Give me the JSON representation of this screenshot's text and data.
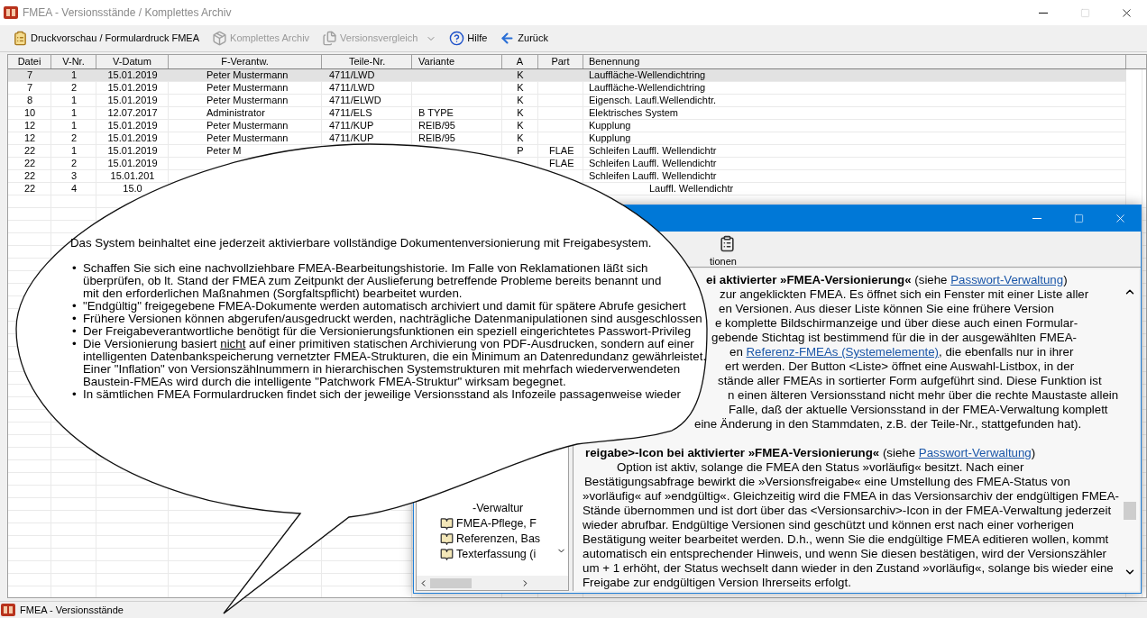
{
  "window": {
    "title": "FMEA - Versionsstände / Komplettes Archiv"
  },
  "toolbar": [
    {
      "kind": "print",
      "label": "Druckvorschau / Formulardruck FMEA",
      "disabled": false,
      "dropdown": false
    },
    {
      "kind": "archive",
      "label": "Komplettes Archiv",
      "disabled": true,
      "dropdown": false
    },
    {
      "kind": "compare",
      "label": "Versionsvergleich",
      "disabled": true,
      "dropdown": true
    },
    {
      "kind": "help",
      "label": "Hilfe",
      "disabled": false,
      "dropdown": false
    },
    {
      "kind": "back",
      "label": "Zurück",
      "disabled": false,
      "dropdown": false
    }
  ],
  "table": {
    "columns": [
      "Datei",
      "V-Nr.",
      "V-Datum",
      "F-Verantw.",
      "Teile-Nr.",
      "Variante",
      "A",
      "Part",
      "Benennung"
    ],
    "rows": [
      {
        "selected": true,
        "cells": [
          "7",
          "1",
          "15.01.2019",
          "Peter Mustermann",
          "4711/LWD",
          "",
          "K",
          "",
          "Lauffläche-Wellendichtring"
        ]
      },
      {
        "selected": false,
        "cells": [
          "7",
          "2",
          "15.01.2019",
          "Peter Mustermann",
          "4711/LWD",
          "",
          "K",
          "",
          "Lauffläche-Wellendichtring"
        ]
      },
      {
        "selected": false,
        "cells": [
          "8",
          "1",
          "15.01.2019",
          "Peter Mustermann",
          "4711/ELWD",
          "",
          "K",
          "",
          "Eigensch. Laufl.Wellendichtr."
        ]
      },
      {
        "selected": false,
        "cells": [
          "10",
          "1",
          "12.07.2017",
          "Administrator",
          "4711/ELS",
          "B  TYPE",
          "K",
          "",
          "Elektrisches System"
        ]
      },
      {
        "selected": false,
        "cells": [
          "12",
          "1",
          "15.01.2019",
          "Peter Mustermann",
          "4711/KUP",
          "REIB/95",
          "K",
          "",
          "Kupplung"
        ]
      },
      {
        "selected": false,
        "cells": [
          "12",
          "2",
          "15.01.2019",
          "Peter Mustermann",
          "4711/KUP",
          "REIB/95",
          "K",
          "",
          "Kupplung"
        ]
      },
      {
        "selected": false,
        "cells": [
          "22",
          "1",
          "15.01.2019",
          "Peter M",
          "",
          "",
          "P",
          "FLAE",
          "Schleifen Lauffl. Wellendichtr"
        ]
      },
      {
        "selected": false,
        "cells": [
          "22",
          "2",
          "15.01.2019",
          "",
          "",
          "",
          "",
          "FLAE",
          "Schleifen Lauffl. Wellendichtr"
        ]
      },
      {
        "selected": false,
        "cells": [
          "22",
          "3",
          "15.01.201",
          "",
          "",
          "",
          "",
          "",
          "Schleifen Lauffl. Wellendichtr"
        ]
      },
      {
        "selected": false,
        "cells": [
          "22",
          "4",
          "15.0",
          "",
          "",
          "",
          "",
          "",
          "Lauffl. Wellendichtr"
        ]
      }
    ]
  },
  "help_window": {
    "toolbar_label": "tionen",
    "tree_items": [
      {
        "kind": "clipped",
        "label": "-Verwaltur"
      },
      {
        "kind": "item",
        "label": "FMEA-Pflege, F"
      },
      {
        "kind": "item",
        "label": "Referenzen, Bas"
      },
      {
        "kind": "item",
        "label": "Texterfassung (i"
      }
    ],
    "paragraphs": [
      {
        "lines": [
          [
            {
              "kind": "bold",
              "text": "ei aktivierter »FMEA-Versionierung«"
            },
            {
              "kind": "text",
              "text": " (siehe "
            },
            {
              "kind": "link",
              "text": "Passwort-Verwaltung"
            },
            {
              "kind": "text",
              "text": ")"
            }
          ],
          [
            {
              "kind": "text",
              "text": "zur angeklickten FMEA. Es öffnet sich ein Fenster mit einer Liste aller"
            }
          ],
          [
            {
              "kind": "text",
              "text": "en Versionen. Aus dieser Liste können Sie eine frühere Version"
            }
          ],
          [
            {
              "kind": "text",
              "text": "e komplette Bildschirmanzeige und über diese auch einen Formular-"
            }
          ],
          [
            {
              "kind": "text",
              "text": "gebende Stichtag ist bestimmend für die in der ausgewählten FMEA-"
            }
          ],
          [
            {
              "kind": "text",
              "text": "en "
            },
            {
              "kind": "link",
              "text": "Referenz-FMEAs (Systemelemente)"
            },
            {
              "kind": "text",
              "text": ", die ebenfalls nur in ihrer"
            }
          ],
          [
            {
              "kind": "text",
              "text": "ert werden. Der Button <Liste> öffnet eine Auswahl-Listbox, in der"
            }
          ],
          [
            {
              "kind": "text",
              "text": "stände aller FMEAs in sortierter Form aufgeführt sind. Diese Funktion ist"
            }
          ],
          [
            {
              "kind": "text",
              "text": "n einen älteren Versionsstand nicht mehr über die rechte Maustaste allein"
            }
          ],
          [
            {
              "kind": "text",
              "text": "Falle, daß der aktuelle Versionsstand in der FMEA-Verwaltung komplett"
            }
          ],
          [
            {
              "kind": "text",
              "text": "eine Änderung in den Stammdaten, z.B. der Teile-Nr., stattgefunden hat)."
            }
          ]
        ]
      },
      {
        "lines": [
          [
            {
              "kind": "bold",
              "text": "reigabe>-Icon bei aktivierter »FMEA-Versionierung«"
            },
            {
              "kind": "text",
              "text": " (siehe "
            },
            {
              "kind": "link",
              "text": "Passwort-Verwaltung"
            },
            {
              "kind": "text",
              "text": ")"
            }
          ],
          [
            {
              "kind": "text",
              "text": "Option ist aktiv, solange die FMEA den Status »vorläufig« besitzt. Nach einer"
            }
          ],
          [
            {
              "kind": "text",
              "text": "Bestätigungsabfrage bewirkt die »Versionsfreigabe« eine Umstellung des FMEA-Status von"
            }
          ],
          [
            {
              "kind": "text",
              "text": "»vorläufig« auf »endgültig«. Gleichzeitig wird die FMEA in das Versionsarchiv der endgültigen FMEA-"
            }
          ],
          [
            {
              "kind": "text",
              "text": "Stände übernommen und ist dort über das <Versionsarchiv>-Icon in der FMEA-Verwaltung jederzeit"
            }
          ],
          [
            {
              "kind": "text",
              "text": "wieder abrufbar. Endgültige Versionen sind geschützt und können erst nach einer vorherigen"
            }
          ],
          [
            {
              "kind": "text",
              "text": "Bestätigung weiter bearbeitet werden. D.h., wenn Sie die endgültige FMEA editieren wollen, kommt"
            }
          ],
          [
            {
              "kind": "text",
              "text": "automatisch ein entsprechender Hinweis, und wenn Sie diesen bestätigen, wird der Versionszähler"
            }
          ],
          [
            {
              "kind": "text",
              "text": "um + 1 erhöht, der Status wechselt dann wieder in den Zustand »vorläufig«, solange bis wieder eine"
            }
          ],
          [
            {
              "kind": "text",
              "text": "Freigabe zur endgültigen Version Ihrerseits erfolgt."
            }
          ]
        ]
      }
    ]
  },
  "callout": {
    "intro": "Das System beinhaltet eine jederzeit aktivierbare vollständige Dokumentenversionierung mit Freigabesystem.",
    "bullets": [
      {
        "marker": "•",
        "segments": [
          {
            "kind": "text",
            "text": "Schaffen Sie sich eine nachvollziehbare FMEA-Bearbeitungshistorie. Im Falle von Reklamationen läßt sich\nüberprüfen, ob lt. Stand der FMEA zum Zeitpunkt der Auslieferung betreffende Probleme bereits benannt und\nmit den erforderlichen Maßnahmen (Sorgfaltspflicht) bearbeitet wurden."
          }
        ]
      },
      {
        "marker": "•",
        "segments": [
          {
            "kind": "text",
            "text": "\"Endgültig\" freigegebene FMEA-Dokumente werden automatisch archiviert und damit für spätere Abrufe gesichert"
          }
        ]
      },
      {
        "marker": "•",
        "segments": [
          {
            "kind": "text",
            "text": "Frühere Versionen können abgerufen/ausgedruckt werden, nachträgliche Datenmanipulationen sind ausgeschlossen"
          }
        ]
      },
      {
        "marker": "•",
        "segments": [
          {
            "kind": "text",
            "text": "Der Freigabeverantwortliche benötigt für die Versionierungsfunktionen ein speziell eingerichtetes Passwort-Privileg"
          }
        ]
      },
      {
        "marker": "•",
        "segments": [
          {
            "kind": "text",
            "text": "Die Versionierung basiert "
          },
          {
            "kind": "underline",
            "text": "nicht"
          },
          {
            "kind": "text",
            "text": " auf einer primitiven statischen Archivierung von PDF-Ausdrucken, sondern auf einer\nintelligenten Datenbankspeicherung vernetzter FMEA-Strukturen, die ein Minimum an Datenredundanz gewährleistet.\nEiner \"Inflation\" von Versionszählnummern in hierarchischen Systemstrukturen mit mehrfach wiederverwendeten\nBaustein-FMEAs wird durch die intelligente \"Patchwork FMEA-Struktur\" wirksam begegnet."
          }
        ]
      },
      {
        "marker": "•",
        "segments": [
          {
            "kind": "text",
            "text": "In sämtlichen FMEA Formulardrucken findet sich der jeweilige Versionsstand als Infozeile passagenweise wieder"
          }
        ]
      }
    ]
  },
  "status_bar": {
    "text": "FMEA - Versionsstände"
  }
}
